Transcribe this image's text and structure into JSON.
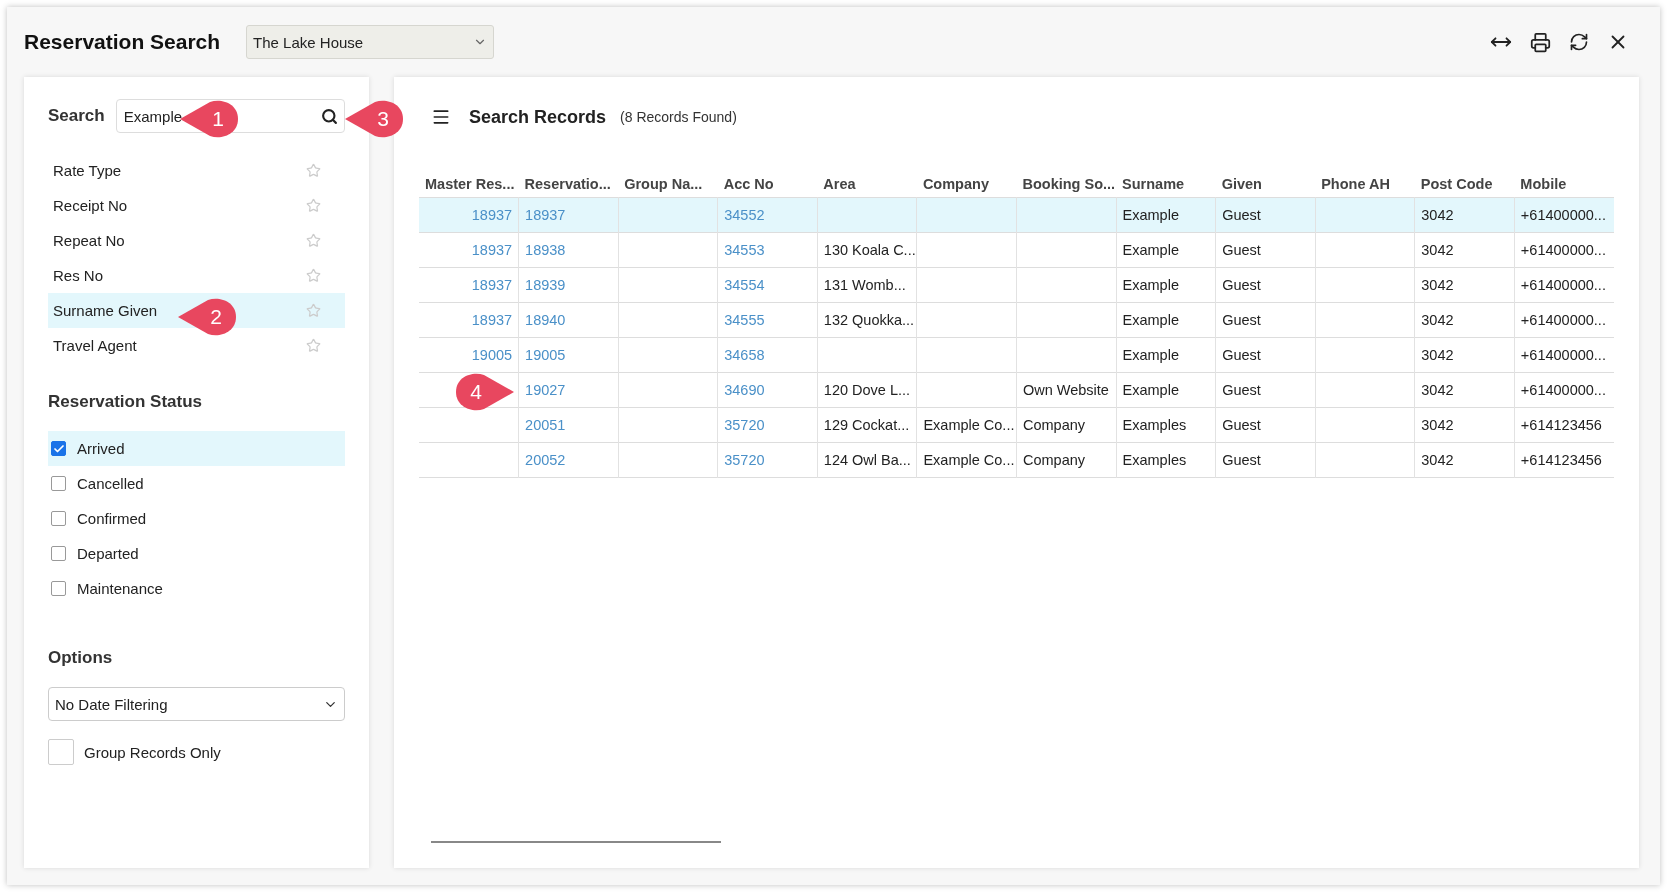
{
  "window": {
    "title": "Reservation Search",
    "property": "The Lake House"
  },
  "search": {
    "label": "Search",
    "value": "Example",
    "fields": [
      {
        "label": "Rate Type",
        "selected": false,
        "favorite": false
      },
      {
        "label": "Receipt No",
        "selected": false,
        "favorite": false
      },
      {
        "label": "Repeat No",
        "selected": false,
        "favorite": false
      },
      {
        "label": "Res No",
        "selected": false,
        "favorite": false
      },
      {
        "label": "Surname Given",
        "selected": true,
        "favorite": false
      },
      {
        "label": "Travel Agent",
        "selected": false,
        "favorite": false
      }
    ]
  },
  "reservation_status": {
    "title": "Reservation Status",
    "items": [
      {
        "label": "Arrived",
        "checked": true,
        "selected": true
      },
      {
        "label": "Cancelled",
        "checked": false,
        "selected": false
      },
      {
        "label": "Confirmed",
        "checked": false,
        "selected": false
      },
      {
        "label": "Departed",
        "checked": false,
        "selected": false
      },
      {
        "label": "Maintenance",
        "checked": false,
        "selected": false
      }
    ]
  },
  "options": {
    "title": "Options",
    "date_filter": "No Date Filtering",
    "group_records_only": {
      "label": "Group Records Only",
      "checked": false
    }
  },
  "records": {
    "title": "Search Records",
    "count": "(8 Records Found)",
    "columns": [
      {
        "label": "Master Res...",
        "kind": "link_right"
      },
      {
        "label": "Reservatio...",
        "kind": "link"
      },
      {
        "label": "Group Na...",
        "kind": "text"
      },
      {
        "label": "Acc No",
        "kind": "link"
      },
      {
        "label": "Area",
        "kind": "text"
      },
      {
        "label": "Company",
        "kind": "text"
      },
      {
        "label": "Booking So...",
        "kind": "text"
      },
      {
        "label": "Surname",
        "kind": "text"
      },
      {
        "label": "Given",
        "kind": "text"
      },
      {
        "label": "Phone AH",
        "kind": "text"
      },
      {
        "label": "Post Code",
        "kind": "text"
      },
      {
        "label": "Mobile",
        "kind": "text"
      }
    ],
    "rows": [
      {
        "selected": true,
        "cells": [
          "18937",
          "18937",
          null,
          "34552",
          null,
          null,
          null,
          "Example",
          "Guest",
          null,
          "3042",
          "+61400000..."
        ]
      },
      {
        "selected": false,
        "cells": [
          "18937",
          "18938",
          null,
          "34553",
          "130 Koala C...",
          null,
          null,
          "Example",
          "Guest",
          null,
          "3042",
          "+61400000..."
        ]
      },
      {
        "selected": false,
        "cells": [
          "18937",
          "18939",
          null,
          "34554",
          "131 Womb...",
          null,
          null,
          "Example",
          "Guest",
          null,
          "3042",
          "+61400000..."
        ]
      },
      {
        "selected": false,
        "cells": [
          "18937",
          "18940",
          null,
          "34555",
          "132 Quokka...",
          null,
          null,
          "Example",
          "Guest",
          null,
          "3042",
          "+61400000..."
        ]
      },
      {
        "selected": false,
        "cells": [
          "19005",
          "19005",
          null,
          "34658",
          null,
          null,
          null,
          "Example",
          "Guest",
          null,
          "3042",
          "+61400000..."
        ]
      },
      {
        "selected": false,
        "cells": [
          null,
          "19027",
          null,
          "34690",
          "120 Dove L...",
          null,
          "Own Website",
          "Example",
          "Guest",
          null,
          "3042",
          "+61400000..."
        ]
      },
      {
        "selected": false,
        "cells": [
          null,
          "20051",
          null,
          "35720",
          "129 Cockat...",
          "Example Co...",
          "Company",
          "Examples",
          "Guest",
          null,
          "3042",
          "+614123456"
        ]
      },
      {
        "selected": false,
        "cells": [
          null,
          "20052",
          null,
          "35720",
          "124 Owl Ba...",
          "Example Co...",
          "Company",
          "Examples",
          "Guest",
          null,
          "3042",
          "+614123456"
        ]
      }
    ]
  },
  "callouts": [
    {
      "number": "1",
      "points_right": false
    },
    {
      "number": "2",
      "points_right": false
    },
    {
      "number": "3",
      "points_right": false
    },
    {
      "number": "4",
      "points_right": true
    }
  ]
}
